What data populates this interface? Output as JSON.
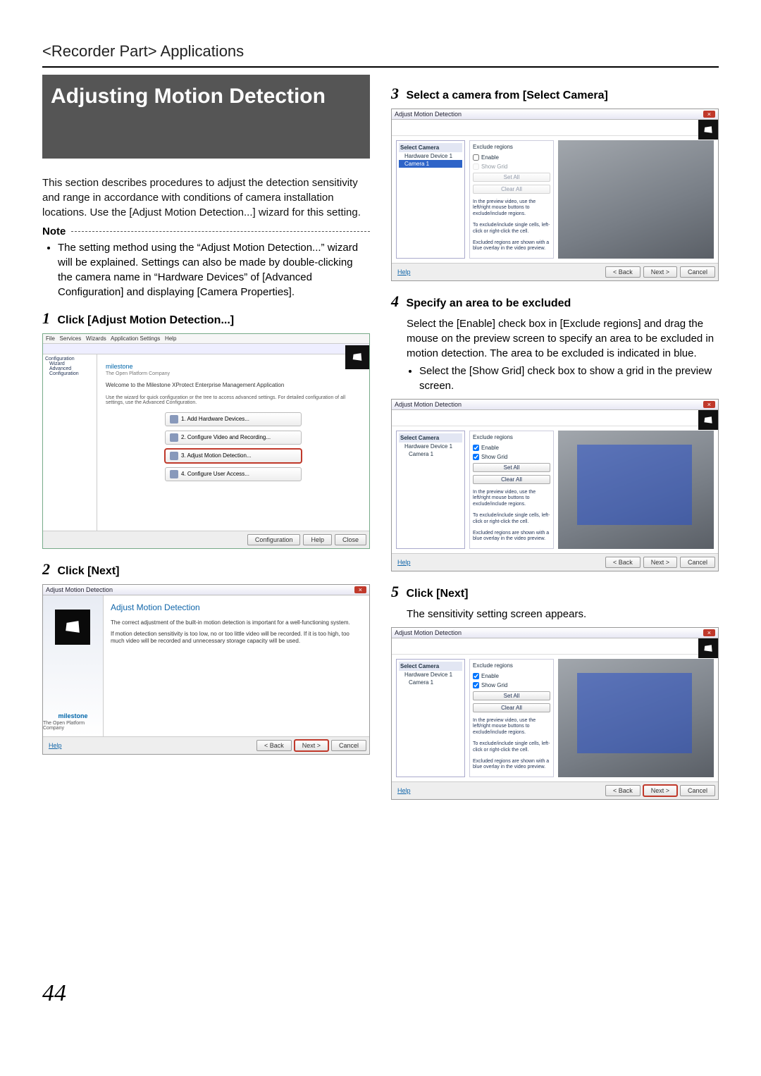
{
  "breadcrumb": "<Recorder Part> Applications",
  "title": "Adjusting Motion Detection",
  "intro": "This section describes procedures to adjust the detection sensitivity and range in accordance with conditions of camera installation locations. Use the [Adjust Motion Detection...] wizard for this setting.",
  "note_label": "Note",
  "note_bullet": "The setting method using the “Adjust Motion Detection...” wizard will be explained. Settings can also be made by double-clicking the camera name in “Hardware Devices” of [Advanced Configuration] and displaying [Camera Properties].",
  "steps": {
    "s1_num": "1",
    "s1_title": "Click [Adjust Motion Detection...]",
    "s2_num": "2",
    "s2_title": "Click [Next]",
    "s3_num": "3",
    "s3_title": "Select a camera from [Select Camera]",
    "s4_num": "4",
    "s4_title": "Specify an area to be excluded",
    "s4_body": "Select the [Enable] check box in [Exclude regions] and drag the mouse on the preview screen to specify an area to be excluded in motion detection. The area to be excluded is indicated in blue.",
    "s4_bullet": "Select the [Show Grid] check box to show a grid in the preview screen.",
    "s5_num": "5",
    "s5_title": "Click [Next]",
    "s5_body": "The sensitivity setting screen appears."
  },
  "shot_main": {
    "welcome": "Welcome to the Milestone XProtect Enterprise Management Application",
    "subwelcome": "Use the wizard for quick configuration or the tree to access advanced settings. For detailed configuration of all settings, use the Advanced Configuration.",
    "tree1": "Configuration",
    "tree2": "Wizard",
    "tree3": "Advanced Configuration",
    "company": "The Open Platform Company",
    "b1": "1. Add Hardware Devices...",
    "b2": "2. Configure Video and Recording...",
    "b3": "3. Adjust Motion Detection...",
    "b4": "4. Configure User Access..."
  },
  "shot_intro": {
    "win_title": "Adjust Motion Detection",
    "heading": "Adjust Motion Detection",
    "p1": "The correct adjustment of the built-in motion detection is important for a well-functioning system.",
    "p2": "If motion detection sensitivity is too low, no or too little video will be recorded. If it is too high, too much video will be recorded and unnecessary storage capacity will be used.",
    "brand": "milestone",
    "sub": "The Open Platform Company",
    "help": "Help",
    "back": "< Back",
    "next": "Next >",
    "cancel": "Cancel"
  },
  "shot_cam": {
    "win_title": "Adjust Motion Detection",
    "select_camera": "Select Camera",
    "hw": "Hardware Device 1",
    "cam1": "Camera 1",
    "exclude": "Exclude regions",
    "enable": "Enable",
    "showgrid": "Show Grid",
    "setall": "Set All",
    "clearall": "Clear All",
    "tip1": "In the preview video, use the left/right mouse buttons to exclude/include regions.",
    "tip2": "To exclude/include single cells, left-click or right-click the cell.",
    "tip3": "Excluded regions are shown with a blue overlay in the video preview.",
    "help": "Help",
    "back": "< Back",
    "next": "Next >",
    "cancel": "Cancel"
  },
  "page_number": "44"
}
